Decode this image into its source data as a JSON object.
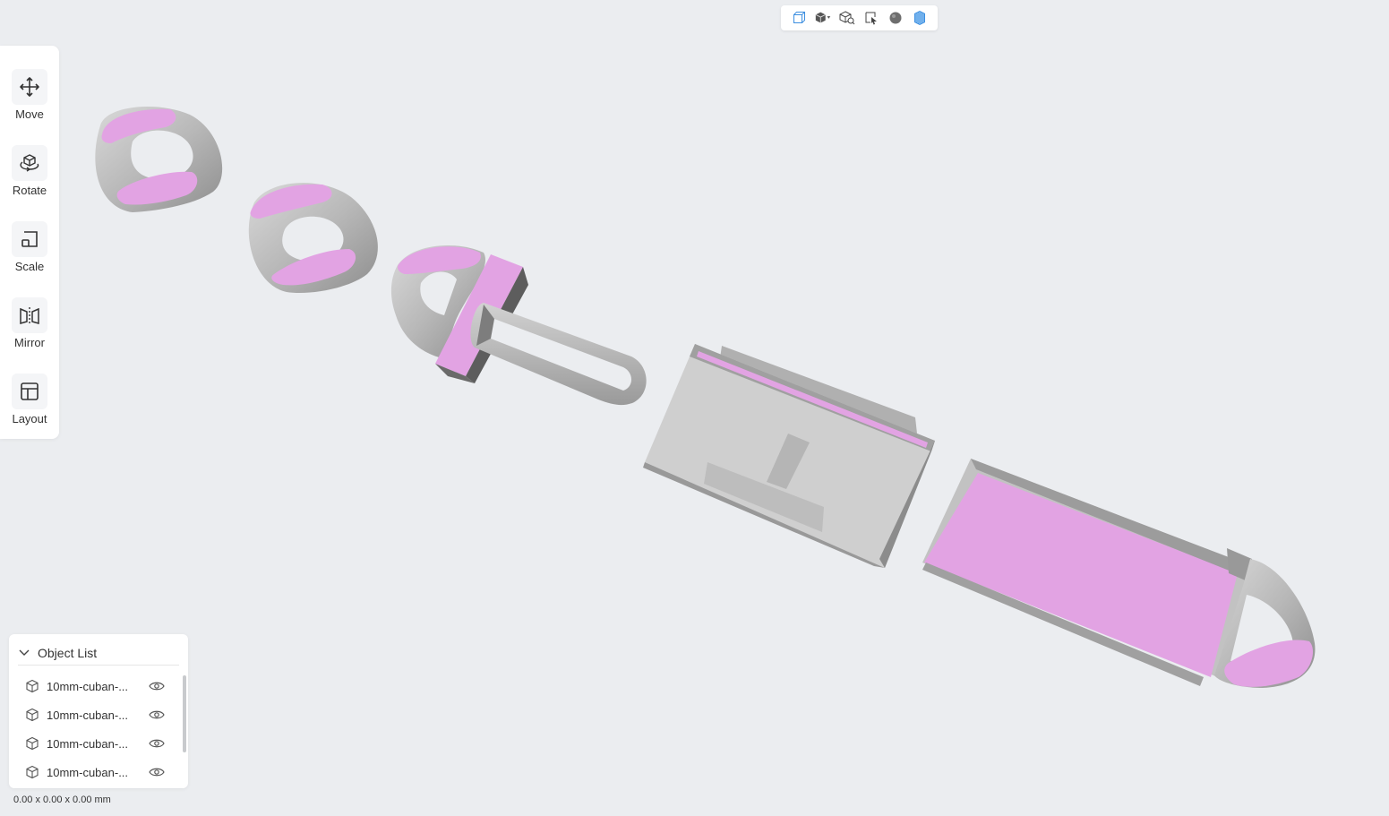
{
  "view_toolbar": {
    "buttons": [
      {
        "icon": "wireframe-box-icon",
        "active": false
      },
      {
        "icon": "solid-cube-dropdown-icon",
        "active": false
      },
      {
        "icon": "box-zoom-icon",
        "active": false
      },
      {
        "icon": "select-cursor-icon",
        "active": false
      },
      {
        "icon": "sphere-icon",
        "active": false
      },
      {
        "icon": "slice-layers-icon",
        "active": true
      }
    ]
  },
  "tools": [
    {
      "label": "Move",
      "icon": "move-arrows-icon"
    },
    {
      "label": "Rotate",
      "icon": "rotate-icon"
    },
    {
      "label": "Scale",
      "icon": "scale-icon"
    },
    {
      "label": "Mirror",
      "icon": "mirror-icon"
    },
    {
      "label": "Layout",
      "icon": "layout-icon"
    }
  ],
  "object_list": {
    "title": "Object List",
    "items": [
      {
        "name": "10mm-cuban-..."
      },
      {
        "name": "10mm-cuban-..."
      },
      {
        "name": "10mm-cuban-..."
      },
      {
        "name": "10mm-cuban-..."
      }
    ]
  },
  "dimensions": "0.00 x 0.00 x 0.00 mm",
  "colors": {
    "background": "#ebedf0",
    "model_gray": "#c4c4c4",
    "face_highlight": "#e2a3e3",
    "accent_blue": "#3d8fe0"
  }
}
